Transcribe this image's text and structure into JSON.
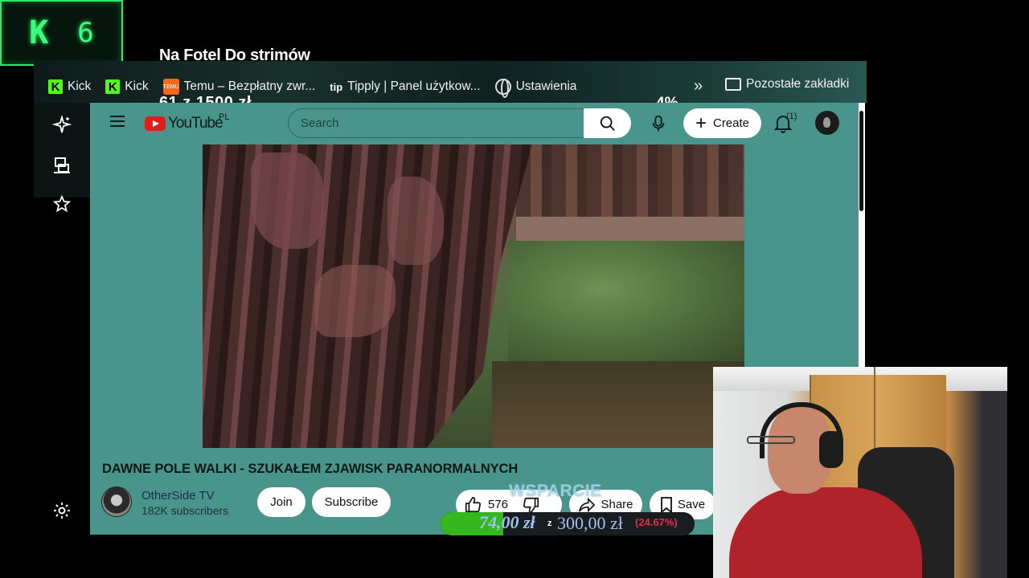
{
  "overlay": {
    "kick_logo_letter": "K",
    "kick_counter": "6",
    "stream_title": "Na Fotel Do strimów",
    "goal_counter": "61  z  1500  zł",
    "goal_percent": "4%"
  },
  "bookmarks": [
    {
      "label": "Kick",
      "icon": "kick-icon"
    },
    {
      "label": "Kick",
      "icon": "kick-icon"
    },
    {
      "label": "Temu – Bezpłatny zwr...",
      "icon": "temu-icon"
    },
    {
      "label": "Tipply | Panel użytkow...",
      "icon": "tipply-icon"
    },
    {
      "label": "Ustawienia",
      "icon": "globe-icon"
    }
  ],
  "bookmarks_more": "»",
  "bookmarks_other": "Pozostałe zakładki",
  "youtube": {
    "logo_text": "YouTube",
    "region": "PL",
    "search_placeholder": "Search",
    "create_label": "Create",
    "notification_count": "(1)",
    "video_title": "DAWNE POLE WALKI - SZUKAŁEM ZJAWISK PARANORMALNYCH",
    "channel_name": "OtherSide TV",
    "subscribers": "182K subscribers",
    "join_label": "Join",
    "subscribe_label": "Subscribe",
    "likes": "576",
    "share_label": "Share",
    "save_label": "Save"
  },
  "donation": {
    "label": "WSPARCIE",
    "current": "74,00 zł",
    "separator": "z",
    "goal": "300,00 zł",
    "percent_text": "(24.67%)",
    "progress_fraction": 0.2467
  },
  "colors": {
    "kick_green": "#53fc18",
    "youtube_bg": "#4a958b",
    "donation_fill": "#34b81e"
  }
}
